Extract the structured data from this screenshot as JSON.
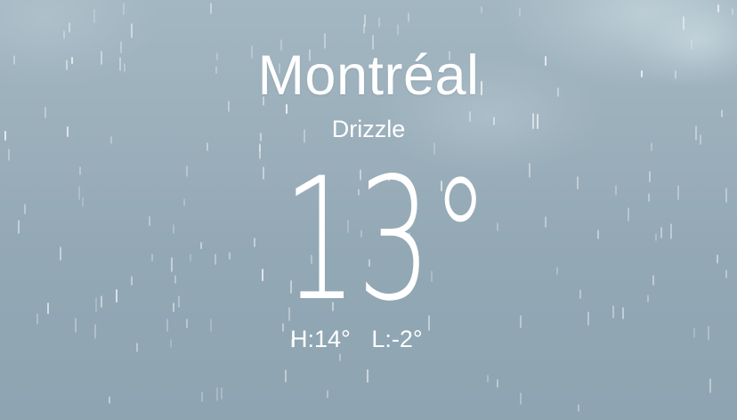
{
  "location": {
    "city": "Montréal",
    "condition": "Drizzle"
  },
  "current": {
    "temperature": "13°"
  },
  "range": {
    "high": "H:14°",
    "low": "L:-2°"
  },
  "colors": {
    "sky_top": "#a3b7c2",
    "sky_bottom": "#8ea4b1",
    "text": "#ffffff"
  },
  "background": {
    "effect": "rain-drizzle-animation"
  }
}
